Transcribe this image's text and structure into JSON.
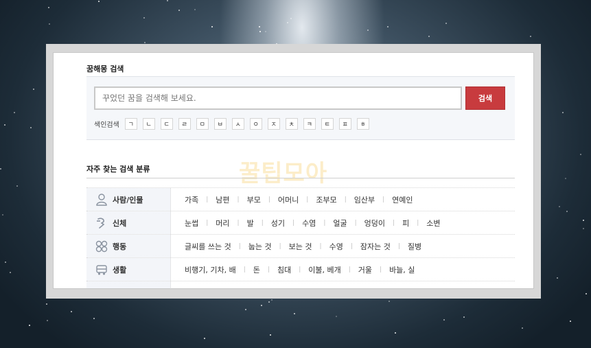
{
  "page": {
    "title": "꿈해몽 검색",
    "search": {
      "placeholder": "꾸었던 꿈을 검색해 보세요.",
      "button_label": "검색"
    },
    "index": {
      "label": "색인검색",
      "consonants": [
        "ㄱ",
        "ㄴ",
        "ㄷ",
        "ㄹ",
        "ㅁ",
        "ㅂ",
        "ㅅ",
        "ㅇ",
        "ㅈ",
        "ㅊ",
        "ㅋ",
        "ㅌ",
        "ㅍ",
        "ㅎ"
      ]
    },
    "watermark": "꿀팁모아",
    "categories_title": "자주 찾는 검색 분류",
    "categories": [
      {
        "name": "사람/인물",
        "icon": "person-icon",
        "items": [
          "가족",
          "남편",
          "부모",
          "어머니",
          "조부모",
          "임산부",
          "연예인"
        ]
      },
      {
        "name": "신체",
        "icon": "body-icon",
        "items": [
          "눈썹",
          "머리",
          "발",
          "성기",
          "수염",
          "얼굴",
          "엉덩이",
          "피",
          "소변"
        ]
      },
      {
        "name": "행동",
        "icon": "action-icon",
        "items": [
          "글씨를 쓰는 것",
          "눕는 것",
          "보는 것",
          "수영",
          "잠자는 것",
          "질병"
        ]
      },
      {
        "name": "생활",
        "icon": "vehicle-icon",
        "items": [
          "비행기, 기차, 배",
          "돈",
          "침대",
          "이불, 베개",
          "거울",
          "바늘, 실"
        ]
      }
    ]
  },
  "colors": {
    "accent": "#c83b3e",
    "category_bg": "#f3f5f9"
  }
}
